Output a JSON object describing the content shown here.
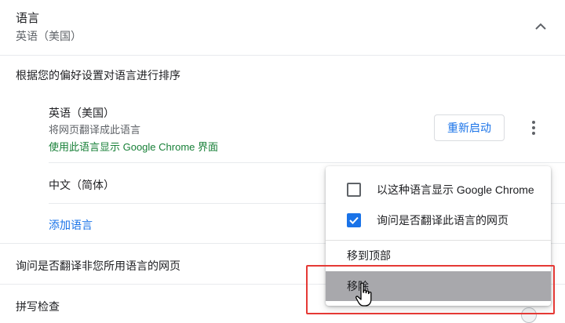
{
  "section": {
    "title": "语言",
    "current_language": "英语（美国）",
    "order_label": "根据您的偏好设置对语言进行排序"
  },
  "languages": [
    {
      "name": "英语（美国）",
      "sub": "将网页翻译成此语言",
      "ui_note": "使用此语言显示 Google Chrome 界面",
      "restart_label": "重新启动"
    },
    {
      "name": "中文（简体）"
    }
  ],
  "add_language_label": "添加语言",
  "offer_translate_label": "询问是否翻译非您所用语言的网页",
  "spell_check_label": "拼写检查",
  "menu": {
    "items": [
      {
        "label": "以这种语言显示 Google Chrome",
        "checked": false
      },
      {
        "label": "询问是否翻译此语言的网页",
        "checked": true
      },
      {
        "label": "移到顶部"
      },
      {
        "label": "移除"
      }
    ]
  },
  "colors": {
    "accent": "#1a73e8",
    "green_note": "#188038",
    "highlight_box": "#e53935"
  }
}
